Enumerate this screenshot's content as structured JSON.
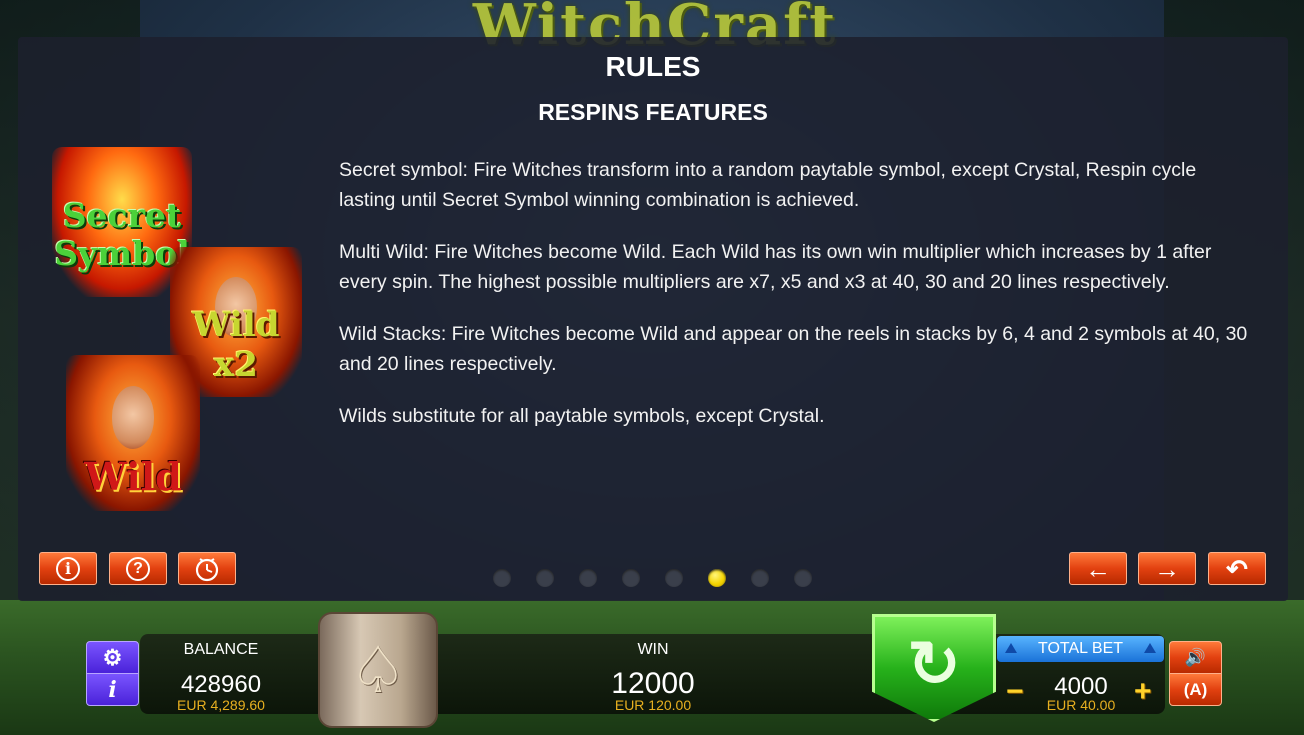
{
  "game": {
    "logo": "WitchCraft"
  },
  "rules": {
    "title": "RULES",
    "subtitle": "RESPINS FEATURES",
    "paragraphs": [
      "Secret symbol: Fire Witches transform into a random paytable symbol, except Crystal, Respin cycle lasting until Secret Symbol winning combination is achieved.",
      "Multi Wild: Fire Witches become Wild. Each Wild has its own win multiplier which increases by 1 after every spin. The highest possible multipliers are x7, x5 and x3 at 40, 30 and 20 lines respectively.",
      "Wild Stacks: Fire Witches become Wild and appear on the reels in stacks by 6, 4 and 2 symbols at 40, 30 and 20 lines respectively.",
      "Wilds substitute for all paytable symbols, except Crystal."
    ],
    "symbols": {
      "secret_line1": "Secret",
      "secret_line2": "Symbol",
      "wild_x2": "Wild x2",
      "wild": "Wild"
    },
    "pagination": {
      "total": 8,
      "active_index": 5
    }
  },
  "controls": {
    "balance_label": "BALANCE",
    "balance_credits": "428960",
    "balance_currency": "EUR 4,289.60",
    "win_label": "WIN",
    "win_credits": "12000",
    "win_currency": "EUR 120.00",
    "total_bet_label": "TOTAL BET",
    "total_bet_credits": "4000",
    "total_bet_currency": "EUR 40.00"
  },
  "icons": {
    "info": "info-icon",
    "help": "help-icon",
    "history": "clock-icon",
    "prev": "arrow-left-icon",
    "next": "arrow-right-icon",
    "back": "return-icon",
    "settings": "gear-icon",
    "spin": "spin-icon",
    "sound": "speaker-icon",
    "autoplay": "autoplay-icon"
  },
  "colors": {
    "panel_bg": "#1c202e",
    "button_orange": "#e24110",
    "active_dot": "#f4d400",
    "currency_text": "#e8b020",
    "spin_green": "#27b21b",
    "bet_blue": "#1a72d8"
  }
}
